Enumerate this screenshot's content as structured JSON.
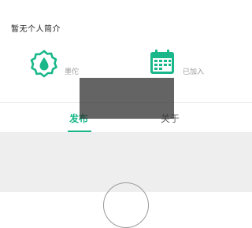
{
  "profile": {
    "bio_placeholder": "暂无个人简介"
  },
  "stats": {
    "bookmark_label": "墨佗",
    "calendar_label": "已加入"
  },
  "tabs": [
    {
      "label": "发布",
      "active": true
    },
    {
      "label": "关于",
      "active": false
    }
  ],
  "colors": {
    "accent": "#19b789",
    "content_background": "#eeeeee",
    "overlay": "rgba(40,40,40,0.72)"
  },
  "icons": {
    "stat_1": "water-drop-badge-icon",
    "stat_2": "calendar-icon"
  }
}
